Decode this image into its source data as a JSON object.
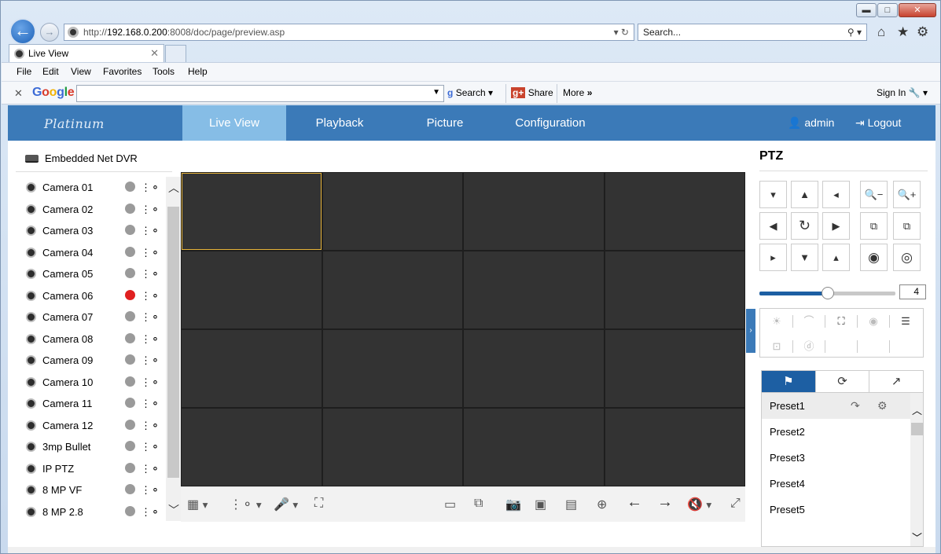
{
  "browser": {
    "window_controls": {
      "minimize": "▬",
      "maximize": "□",
      "close": "✕"
    },
    "back_glyph": "←",
    "forward_glyph": "→",
    "address": {
      "prefix": "http://",
      "host": "192.168.0.200",
      "rest": ":8008/doc/page/preview.asp",
      "controls": "▾ ↻"
    },
    "search_placeholder": "Search...",
    "search_controls": "⚲ ▾",
    "tab": {
      "title": "Live View",
      "close": "✕"
    },
    "menu": [
      "File",
      "Edit",
      "View",
      "Favorites",
      "Tools",
      "Help"
    ],
    "google_toolbar": {
      "close": "✕",
      "logo_letters": [
        "G",
        "o",
        "o",
        "g",
        "l",
        "e"
      ],
      "logo_colors": [
        "#3c6bd6",
        "#d93b2b",
        "#f2b307",
        "#3c6bd6",
        "#1e9a3e",
        "#d93b2b"
      ],
      "search_label": "Search",
      "share_label": "Share",
      "more_label": "More",
      "more_glyph": "»",
      "signin_label": "Sign In"
    }
  },
  "app": {
    "brand": "Platinum",
    "nav": [
      {
        "label": "Live View",
        "active": true
      },
      {
        "label": "Playback",
        "active": false
      },
      {
        "label": "Picture",
        "active": false
      },
      {
        "label": "Configuration",
        "active": false
      }
    ],
    "user": "admin",
    "logout": "Logout",
    "device_title": "Embedded Net DVR",
    "cameras": [
      {
        "name": "Camera 01",
        "recording": false
      },
      {
        "name": "Camera 02",
        "recording": false
      },
      {
        "name": "Camera 03",
        "recording": false
      },
      {
        "name": "Camera 04",
        "recording": false
      },
      {
        "name": "Camera 05",
        "recording": false
      },
      {
        "name": "Camera 06",
        "recording": true
      },
      {
        "name": "Camera 07",
        "recording": false
      },
      {
        "name": "Camera 08",
        "recording": false
      },
      {
        "name": "Camera 09",
        "recording": false
      },
      {
        "name": "Camera 10",
        "recording": false
      },
      {
        "name": "Camera 11",
        "recording": false
      },
      {
        "name": "Camera 12",
        "recording": false
      },
      {
        "name": "3mp Bullet",
        "recording": false
      },
      {
        "name": "IP PTZ",
        "recording": false
      },
      {
        "name": "8 MP VF",
        "recording": false
      },
      {
        "name": "8 MP 2.8",
        "recording": false
      }
    ],
    "video_grid": {
      "rows": 4,
      "cols": 4,
      "selected_cell": 0
    },
    "ptz": {
      "title": "PTZ",
      "speed": 4,
      "speed_max": 7,
      "tabs": [
        "preset-tab",
        "patrol-tab",
        "pattern-tab"
      ],
      "presets": [
        "Preset1",
        "Preset2",
        "Preset3",
        "Preset4",
        "Preset5"
      ]
    },
    "colors": {
      "header": "#3b7ab8",
      "active_tab": "#86bde6",
      "accent": "#1d5fa3",
      "recording": "#e02020"
    }
  }
}
